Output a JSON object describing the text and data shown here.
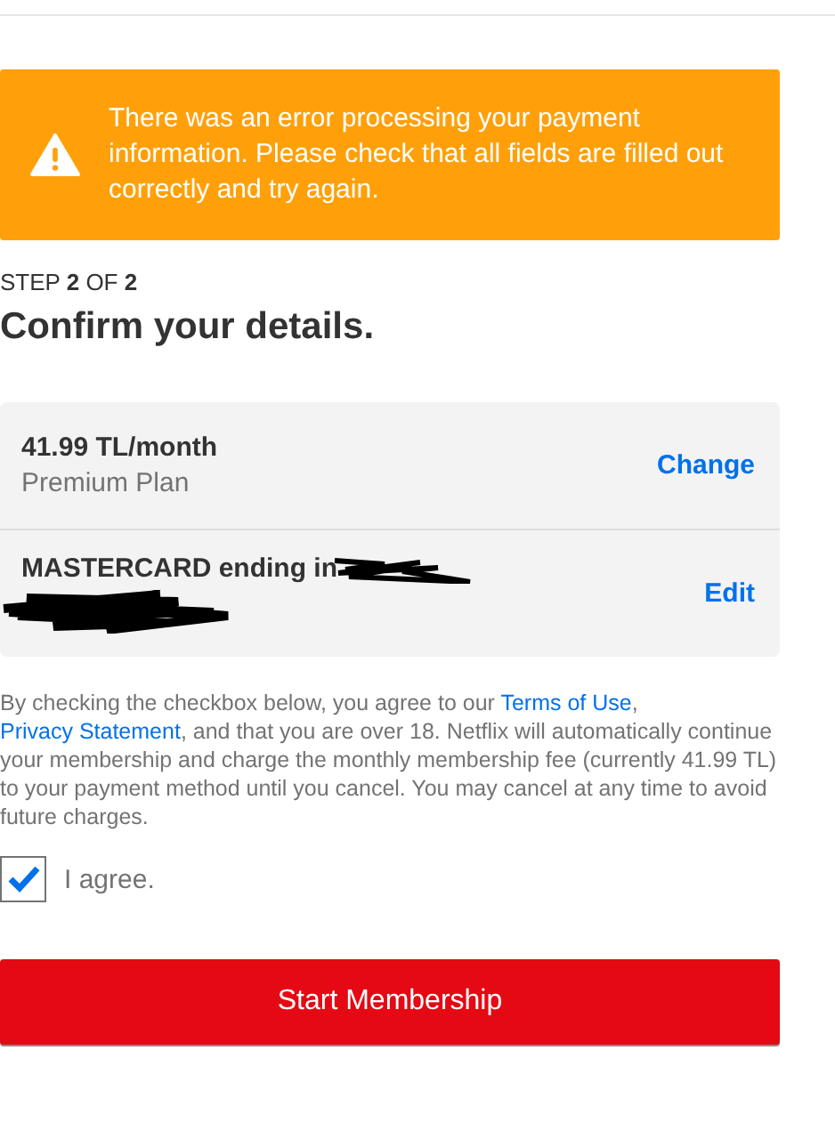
{
  "alert": {
    "message": "There was an error processing your payment information. Please check that all fields are filled out correctly and try again."
  },
  "step": {
    "prefix": "STEP ",
    "current": "2",
    "middle": " OF ",
    "total": "2"
  },
  "title": "Confirm your details.",
  "summary": [
    {
      "kind": "plan",
      "primary": "41.99 TL/month",
      "secondary": "Premium Plan",
      "action": "Change"
    },
    {
      "kind": "payment",
      "primary": "MASTERCARD ending in",
      "action": "Edit"
    }
  ],
  "legal": [
    {
      "kind": "text",
      "text": "By checking the checkbox below, you agree to our "
    },
    {
      "kind": "link",
      "text": "Terms of Use"
    },
    {
      "kind": "text",
      "text": ", "
    },
    {
      "kind": "link",
      "text": "Privacy Statement"
    },
    {
      "kind": "text",
      "text": ", and that you are over 18. Netflix will automatically continue your membership and charge the monthly membership fee (currently 41.99 TL) to your payment method until you cancel. You may cancel at any time to avoid future charges."
    }
  ],
  "agree": {
    "label": "I agree.",
    "checked": true
  },
  "submit": "Start Membership"
}
